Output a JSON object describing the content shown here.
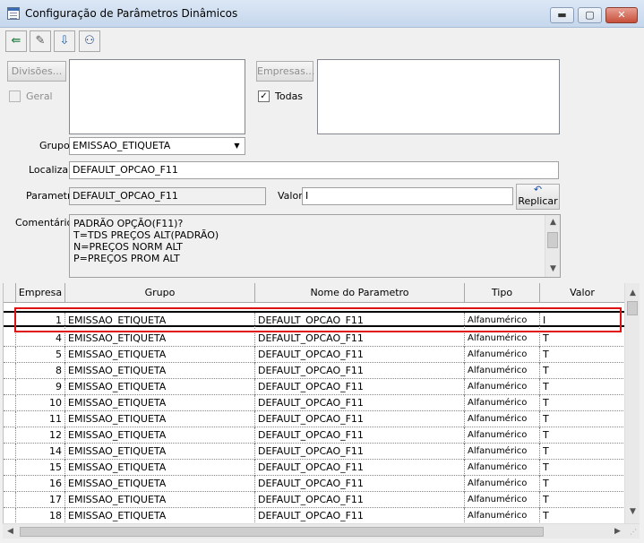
{
  "window": {
    "title": "Configuração de Parâmetros Dinâmicos",
    "min_icon": "▬",
    "max_icon": "▢",
    "close_icon": "✕"
  },
  "toolbar": {
    "buttons": [
      {
        "name": "exit-icon",
        "glyph": "⇚"
      },
      {
        "name": "eraser-icon",
        "glyph": "✎"
      },
      {
        "name": "download-icon",
        "glyph": "⇩"
      },
      {
        "name": "binoculars-icon",
        "glyph": "⚇"
      }
    ]
  },
  "filters": {
    "divisoes_button": "Divisões...",
    "geral_label": "Geral",
    "geral_checked": false,
    "empresas_button": "Empresas...",
    "todas_label": "Todas",
    "todas_checked": true,
    "check_glyph": "✓"
  },
  "form": {
    "grupo_label": "Grupo",
    "grupo_value": "EMISSAO_ETIQUETA",
    "localizar_label": "Localizar",
    "localizar_value": "DEFAULT_OPCAO_F11",
    "parametro_label": "Parametro",
    "parametro_value": "DEFAULT_OPCAO_F11",
    "valor_label": "Valor",
    "valor_value": "I",
    "replicar_label": "Replicar",
    "comentarios_label": "Comentários",
    "comentarios_lines": [
      "PADRÃO OPÇÃO(F11)?",
      "T=TDS PREÇOS ALT(PADRÃO)",
      "N=PREÇOS NORM ALT",
      "P=PREÇOS PROM ALT"
    ]
  },
  "grid": {
    "headers": [
      "Empresa",
      "Grupo",
      "Nome do Parametro",
      "Tipo",
      "Valor"
    ],
    "rows": [
      [
        "1",
        "EMISSAO_ETIQUETA",
        "DEFAULT_OPCAO_F11",
        "Alfanumérico",
        "I"
      ],
      [
        "4",
        "EMISSAO_ETIQUETA",
        "DEFAULT_OPCAO_F11",
        "Alfanumérico",
        "T"
      ],
      [
        "5",
        "EMISSAO_ETIQUETA",
        "DEFAULT_OPCAO_F11",
        "Alfanumérico",
        "T"
      ],
      [
        "8",
        "EMISSAO_ETIQUETA",
        "DEFAULT_OPCAO_F11",
        "Alfanumérico",
        "T"
      ],
      [
        "9",
        "EMISSAO_ETIQUETA",
        "DEFAULT_OPCAO_F11",
        "Alfanumérico",
        "T"
      ],
      [
        "10",
        "EMISSAO_ETIQUETA",
        "DEFAULT_OPCAO_F11",
        "Alfanumérico",
        "T"
      ],
      [
        "11",
        "EMISSAO_ETIQUETA",
        "DEFAULT_OPCAO_F11",
        "Alfanumérico",
        "T"
      ],
      [
        "12",
        "EMISSAO_ETIQUETA",
        "DEFAULT_OPCAO_F11",
        "Alfanumérico",
        "T"
      ],
      [
        "14",
        "EMISSAO_ETIQUETA",
        "DEFAULT_OPCAO_F11",
        "Alfanumérico",
        "T"
      ],
      [
        "15",
        "EMISSAO_ETIQUETA",
        "DEFAULT_OPCAO_F11",
        "Alfanumérico",
        "T"
      ],
      [
        "16",
        "EMISSAO_ETIQUETA",
        "DEFAULT_OPCAO_F11",
        "Alfanumérico",
        "T"
      ],
      [
        "17",
        "EMISSAO_ETIQUETA",
        "DEFAULT_OPCAO_F11",
        "Alfanumérico",
        "T"
      ],
      [
        "18",
        "EMISSAO_ETIQUETA",
        "DEFAULT_OPCAO_F11",
        "Alfanumérico",
        "T"
      ]
    ],
    "highlight_color": "#e01010"
  },
  "scroll": {
    "up": "▲",
    "down": "▼",
    "left": "◀",
    "right": "▶",
    "dropdown": "▼"
  }
}
